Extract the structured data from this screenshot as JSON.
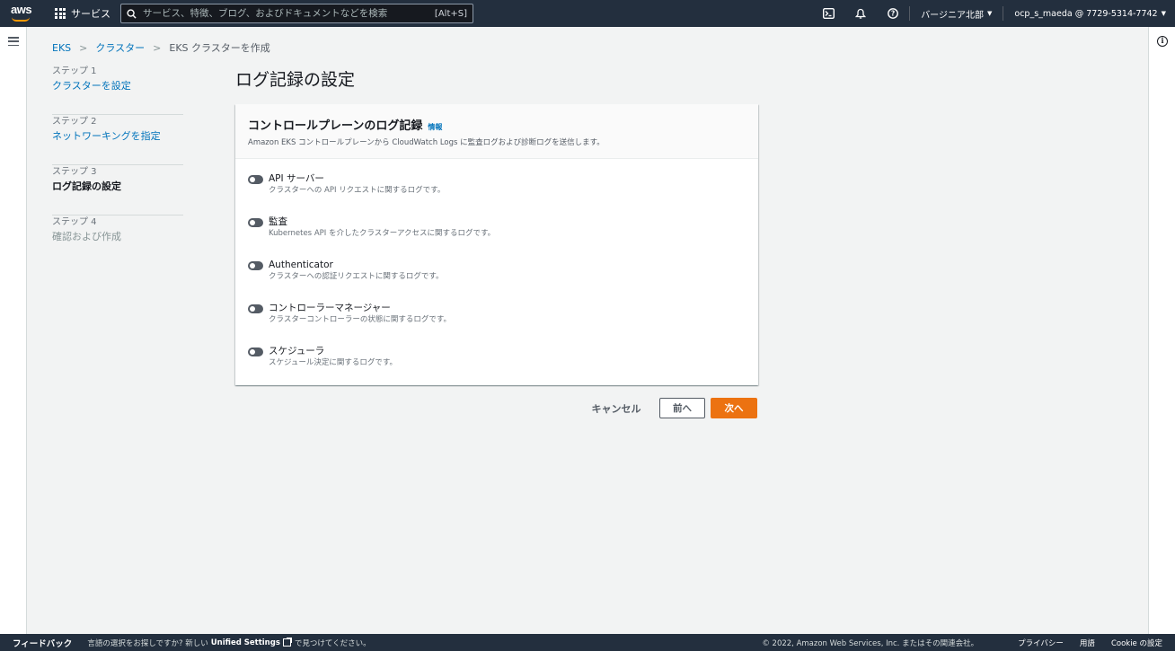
{
  "topnav": {
    "logo_text": "aws",
    "services_label": "サービス",
    "search_placeholder": "サービス、特徴、ブログ、およびドキュメントなどを検索",
    "search_shortcut": "[Alt+S]",
    "region": "バージニア北部",
    "account": "ocp_s_maeda @ 7729-5314-7742"
  },
  "breadcrumb": {
    "items": [
      "EKS",
      "クラスター"
    ],
    "current": "EKS クラスターを作成"
  },
  "steps": [
    {
      "number": "ステップ 1",
      "title": "クラスターを設定"
    },
    {
      "number": "ステップ 2",
      "title": "ネットワーキングを指定"
    },
    {
      "number": "ステップ 3",
      "title": "ログ記録の設定"
    },
    {
      "number": "ステップ 4",
      "title": "確認および作成"
    }
  ],
  "page_title": "ログ記録の設定",
  "panel": {
    "title": "コントロールプレーンのログ記録",
    "info_link": "情報",
    "description": "Amazon EKS コントロールプレーンから CloudWatch Logs に監査ログおよび診断ログを送信します。",
    "options": [
      {
        "label": "API サーバー",
        "desc": "クラスターへの API リクエストに関するログです。",
        "enabled": false
      },
      {
        "label": "監査",
        "desc": "Kubernetes API を介したクラスターアクセスに関するログです。",
        "enabled": false
      },
      {
        "label": "Authenticator",
        "desc": "クラスターへの認証リクエストに関するログです。",
        "enabled": false
      },
      {
        "label": "コントローラーマネージャー",
        "desc": "クラスターコントローラーの状態に関するログです。",
        "enabled": false
      },
      {
        "label": "スケジューラ",
        "desc": "スケジュール決定に関するログです。",
        "enabled": false
      }
    ]
  },
  "actions": {
    "cancel": "キャンセル",
    "previous": "前へ",
    "next": "次へ"
  },
  "footer": {
    "feedback": "フィードバック",
    "lang_note": "言語の選択をお探しですか? 新しい",
    "unified_settings": "Unified Settings",
    "lang_note_end": "で見つけてください。",
    "copyright": "© 2022, Amazon Web Services, Inc. またはその関連会社。",
    "privacy": "プライバシー",
    "terms": "用語",
    "cookie": "Cookie の設定"
  },
  "colors": {
    "nav_bg": "#232f3e",
    "accent_orange": "#ec7211",
    "link_blue": "#0073bb"
  }
}
